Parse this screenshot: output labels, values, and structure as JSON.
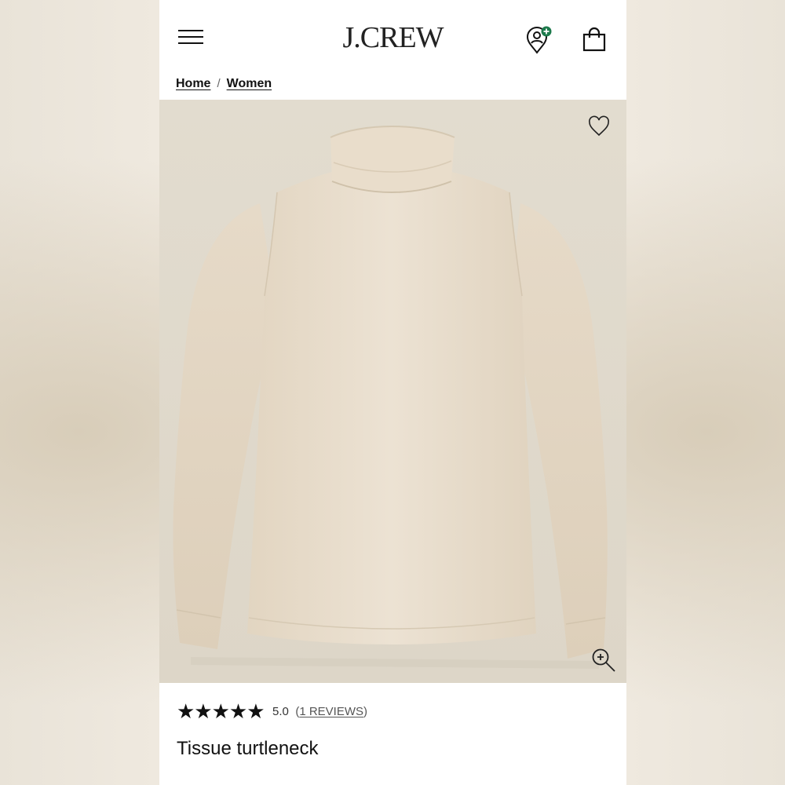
{
  "brand": {
    "logo_text": "J.CREW"
  },
  "header": {
    "menu_icon": "hamburger-menu-icon",
    "account_icon": "account-location-icon",
    "bag_icon": "shopping-bag-icon",
    "account_badge_color": "#1d7a4c"
  },
  "breadcrumb": {
    "items": [
      {
        "label": "Home"
      },
      {
        "label": "Women"
      }
    ],
    "separator": "/"
  },
  "product": {
    "image_alt_color": "#e4ded2",
    "garment_color": "#eadfce",
    "wishlist_icon": "heart-outline-icon",
    "zoom_icon": "zoom-in-icon",
    "rating": {
      "stars_filled": 5,
      "stars_total": 5,
      "score_text": "5.0",
      "reviews_open": "(",
      "reviews_text": "1 REVIEWS",
      "reviews_close": ")"
    },
    "name": "Tissue turtleneck"
  }
}
